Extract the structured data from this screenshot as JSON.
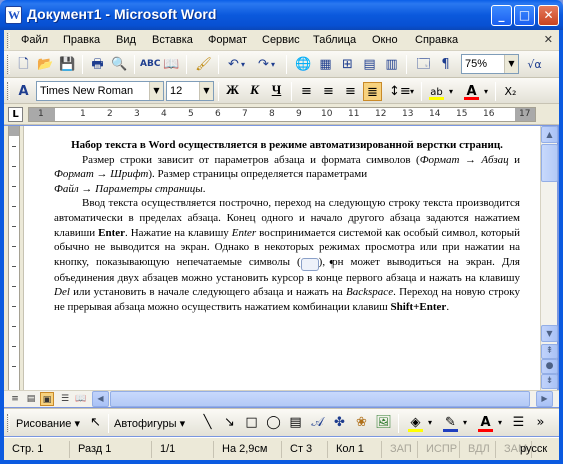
{
  "window": {
    "title": "Документ1 - Microsoft Word",
    "app_icon_letter": "W",
    "minimize": "_",
    "maximize": "□",
    "close": "✕"
  },
  "menu": {
    "items": [
      "Файл",
      "Правка",
      "Вид",
      "Вставка",
      "Формат",
      "Сервис",
      "Таблица",
      "Окно",
      "Справка"
    ],
    "close_doc": "✕"
  },
  "standard_toolbar": {
    "zoom": "75%"
  },
  "formatting_toolbar": {
    "style_icon": "A",
    "font_name": "Times New Roman",
    "font_size": "12",
    "bold": "Ж",
    "italic": "К",
    "underline": "Ч",
    "highlight_color": "#ffff00",
    "font_color": "#ff0000"
  },
  "ruler": {
    "tab_selector": "L",
    "numbers": [
      "1",
      "1",
      "2",
      "3",
      "4",
      "5",
      "6",
      "7",
      "8",
      "9",
      "10",
      "11",
      "12",
      "13",
      "14",
      "15",
      "16",
      "17"
    ]
  },
  "document": {
    "heading": "Набор текста в Word осуществляется в режиме автоматизированной верстки страниц.",
    "para2": {
      "line1_a": "Размер строки зависит от параметров абзаца и формата символов (",
      "line1_i1": "Формат",
      "arrow": "→",
      "line1_i2": "Абзац",
      "line2_a": " и ",
      "line2_i1": "Формат",
      "line2_i2": "Шрифт",
      "line2_b": "). Размер страницы определяется параметрами",
      "line3_i1": "Файл",
      "line3_i2": "Параметры страницы",
      "line3_end": "."
    },
    "para3": {
      "t1": "Ввод текста осуществляется построчно, переход на следующую строку текста производится автоматически в пределах абзаца. Конец одного и начало другого абзаца задаются нажатием клавиши ",
      "enter_bold": "Enter",
      "t2": ". Нажатие на клавишу ",
      "enter_italic": "Enter",
      "t3": " воспринимается системой как особый символ, который обычно не выводится на экран. Однако в некоторых режимах просмотра или при нажатии на кнопку, показывающую непечатаемые символы (",
      "pilcrow": "¶",
      "t4": "), он может выводиться на экран. Для объединения двух абзацев можно установить курсор в конце первого абзаца и нажать на клавишу ",
      "del_italic": "Del",
      "t5": " или установить в начале следующего абзаца и нажать на ",
      "backspace_italic": "Backspace",
      "t6": ". Переход на новую строку не прерывая абзаца можно осуществить нажатием комбинации клавиш ",
      "shift_enter_bold": "Shift+Enter",
      "t7": "."
    }
  },
  "drawing_toolbar": {
    "draw_menu": "Рисование ▾",
    "autoshapes_menu": "Автофигуры ▾",
    "fill_color": "#ffff00",
    "line_color": "#1f3fbf",
    "font_color": "#ff0000"
  },
  "status_bar": {
    "page": "Стр. 1",
    "section": "Разд 1",
    "pages": "1/1",
    "position": "На 2,9см",
    "line": "Ст 3",
    "column": "Кол 1",
    "rec": "ЗАП",
    "trk": "ИСПР",
    "ext": "ВДЛ",
    "ovr": "ЗАМ",
    "language": "русск"
  }
}
